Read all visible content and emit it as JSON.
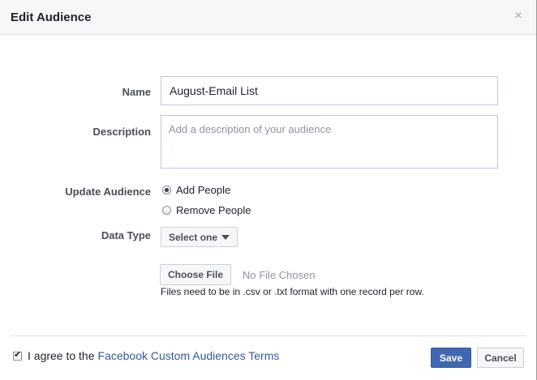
{
  "dialog": {
    "title": "Edit Audience",
    "close_glyph": "×"
  },
  "form": {
    "name_label": "Name",
    "name_value": "August-Email List",
    "description_label": "Description",
    "description_placeholder": "Add a description of your audience",
    "update_label": "Update Audience",
    "update_options": [
      {
        "label": "Add People",
        "selected": true
      },
      {
        "label": "Remove People",
        "selected": false
      }
    ],
    "data_type_label": "Data Type",
    "data_type_selected": "Select one",
    "choose_file_label": "Choose File",
    "file_status": "No File Chosen",
    "file_hint": "Files need to be in .csv or .txt format with one record per row."
  },
  "footer": {
    "agree_text": "I agree to the",
    "terms_link": "Facebook Custom Audiences Terms",
    "agree_checked": true,
    "save_label": "Save",
    "cancel_label": "Cancel"
  },
  "colors": {
    "primary": "#4267b2",
    "link": "#365899",
    "header_bg": "#f6f7f9"
  },
  "icons": {
    "close": "close-icon",
    "dropdown": "caret-down-icon",
    "check": "checkmark-icon"
  }
}
